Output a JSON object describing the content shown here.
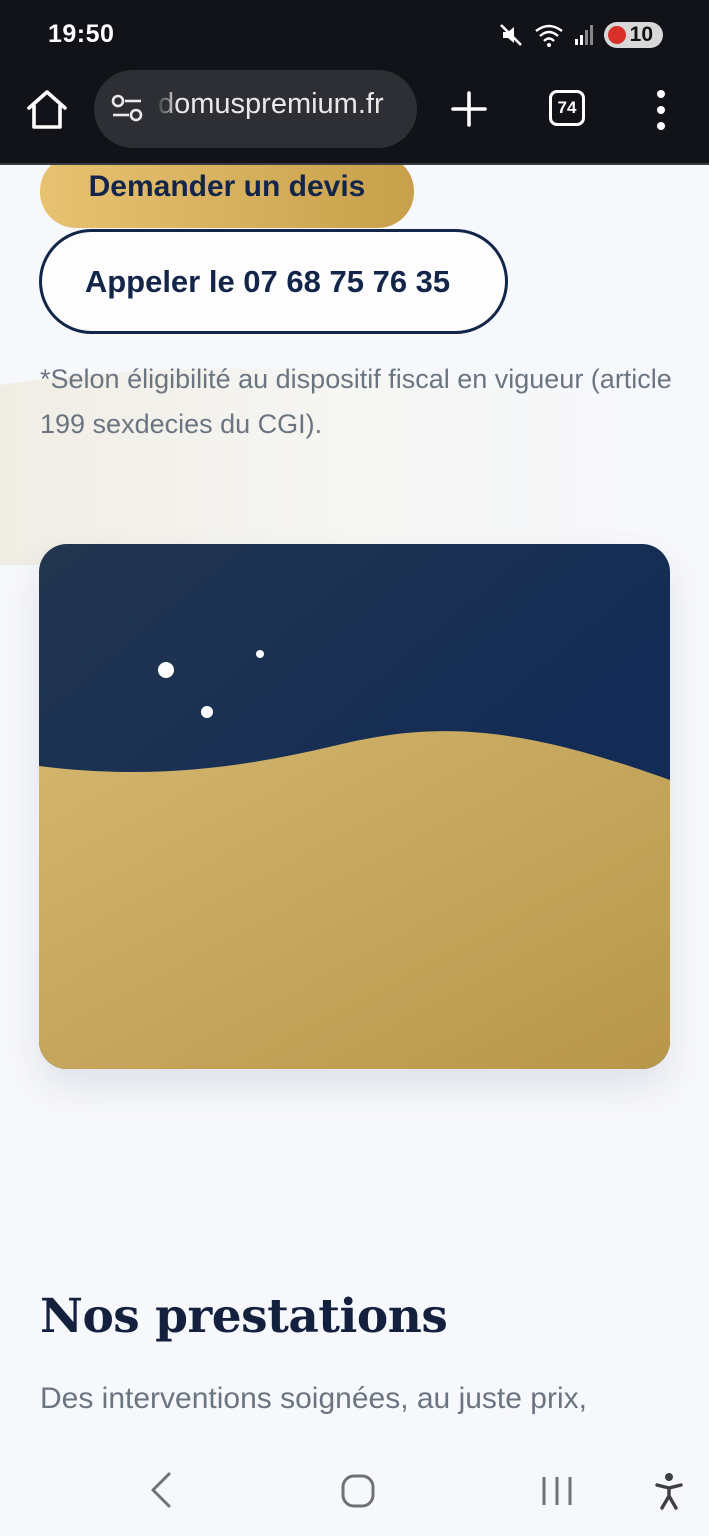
{
  "status_bar": {
    "time": "19:50",
    "icons": [
      "mute-icon",
      "wifi-icon",
      "signal-icon"
    ],
    "battery_level": "10"
  },
  "browser": {
    "url": "domuspremium.fr",
    "tab_count": "74"
  },
  "page": {
    "quote_button": "Demander un devis",
    "call_button": "Appeler le 07 68 75 76 35",
    "footnote": "*Selon éligibilité au dispositif fiscal en vigueur (article 199 sexdecies du CGI).",
    "section_title": "Nos prestations",
    "section_subtitle": "Des interventions soignées, au juste prix,"
  },
  "colors": {
    "navy": "#13264a",
    "gold": "#c9a356",
    "background": "#f7f8fc",
    "muted_text": "#6b7582"
  },
  "nav_bar": {
    "buttons": [
      "back-icon",
      "home-icon",
      "recents-icon",
      "accessibility-icon"
    ]
  }
}
